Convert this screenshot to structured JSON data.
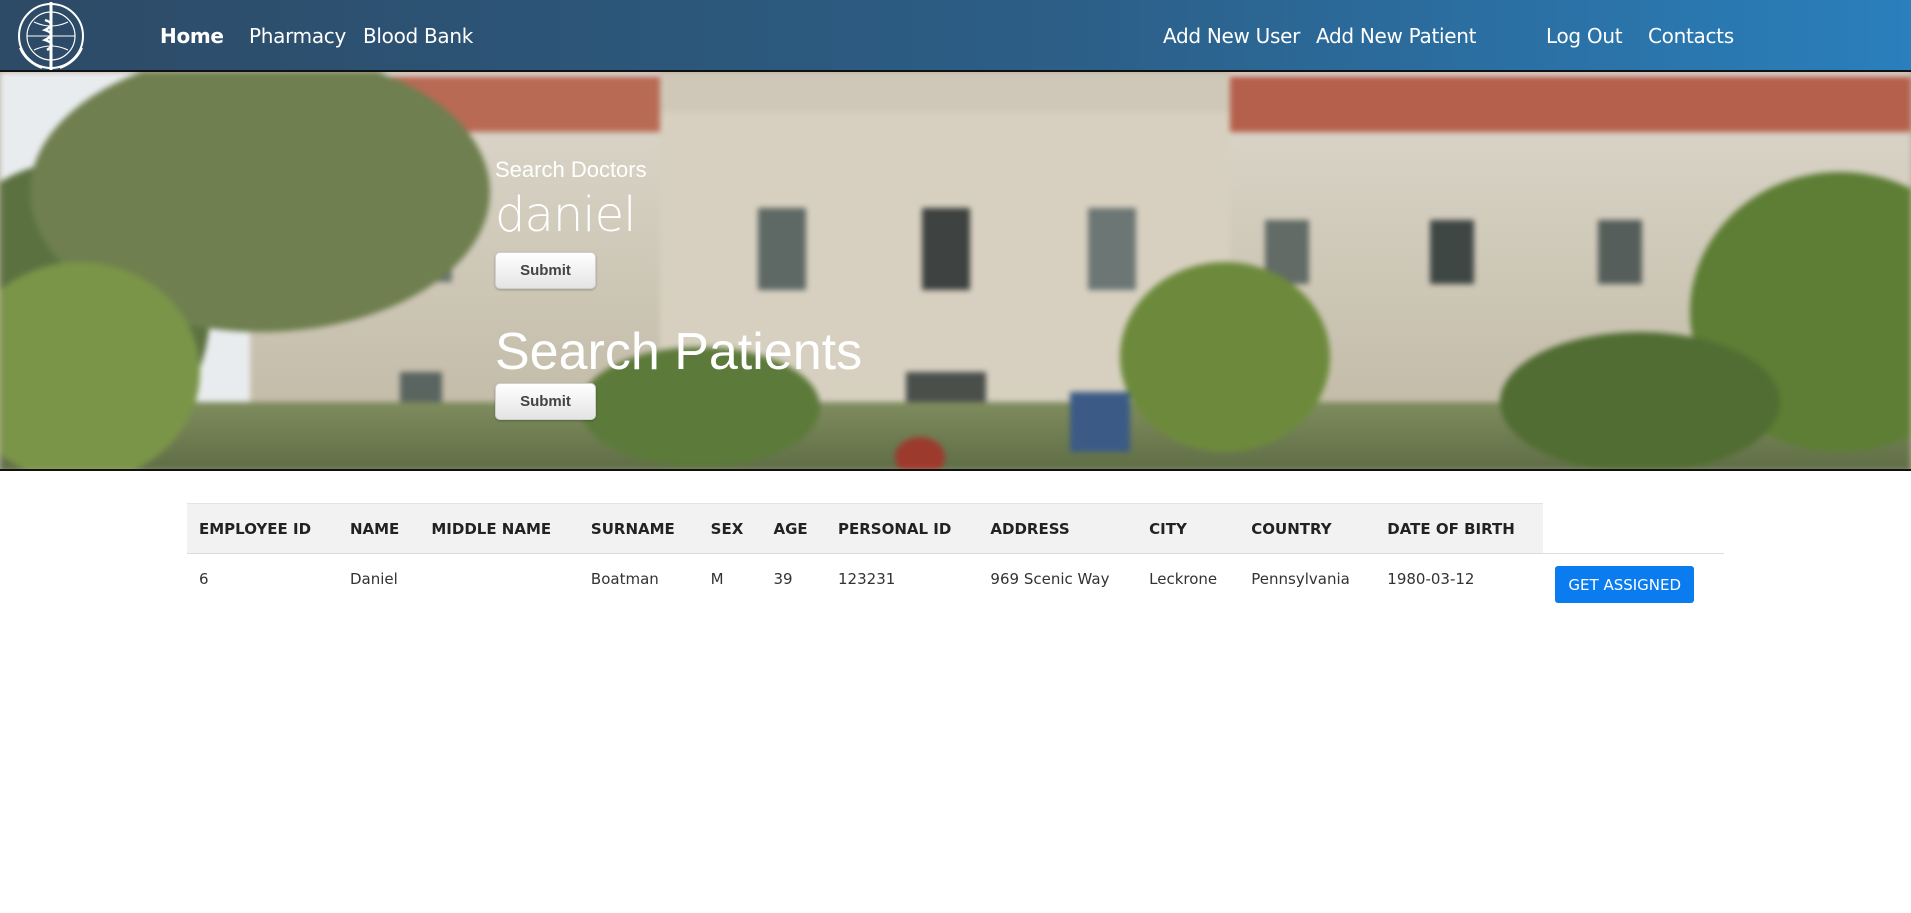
{
  "nav": {
    "logo_alt": "WHO emblem",
    "home": "Home",
    "pharmacy": "Pharmacy",
    "blood_bank": "Blood Bank",
    "add_new_user": "Add New User",
    "add_new_patient": "Add New Patient",
    "log_out": "Log Out",
    "contacts": "Contacts"
  },
  "search": {
    "doctors_label": "Search Doctors",
    "doctors_value": "daniel",
    "doctors_submit": "Submit",
    "patients_label": "Search Patients",
    "patients_submit": "Submit"
  },
  "table": {
    "headers": [
      "EMPLOYEE ID",
      "NAME",
      "MIDDLE NAME",
      "SURNAME",
      "SEX",
      "AGE",
      "PERSONAL ID",
      "ADDRESS",
      "CITY",
      "COUNTRY",
      "DATE OF BIRTH"
    ],
    "rows": [
      {
        "cells": [
          "6",
          "Daniel",
          "",
          "Boatman",
          "M",
          "39",
          "123231",
          "969 Scenic Way",
          "Leckrone",
          "Pennsylvania",
          "1980-03-12"
        ],
        "action": "GET ASSIGNED"
      }
    ]
  },
  "colors": {
    "nav_gradient_start": "#2d4a66",
    "nav_gradient_end": "#2a7fbc",
    "primary_button": "#0a7cf0",
    "table_header_bg": "#f2f2f2"
  }
}
